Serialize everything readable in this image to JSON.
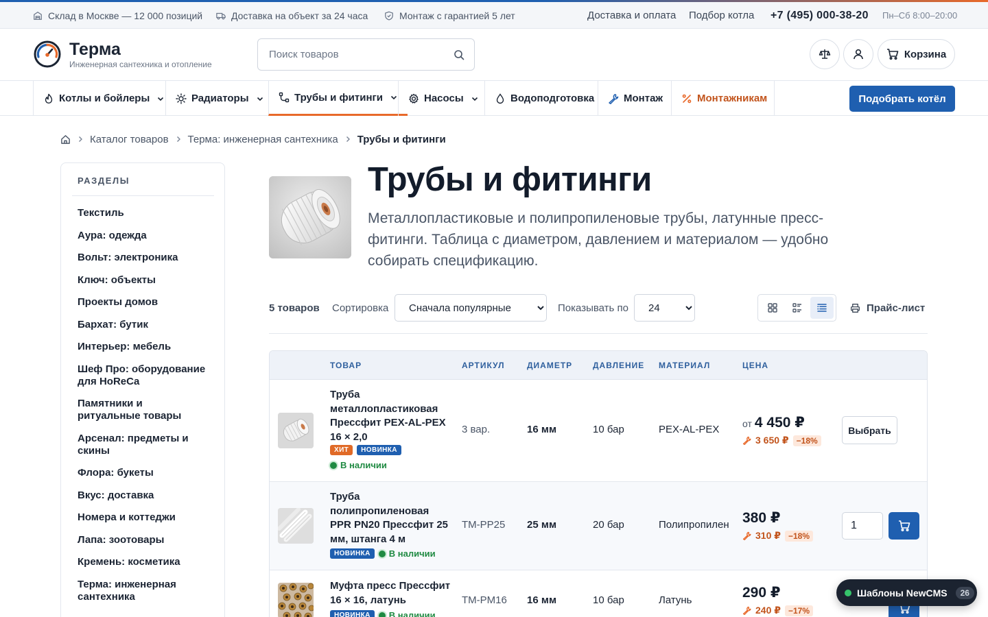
{
  "topbar": {
    "items": [
      "Склад в Москве — 12 000 позиций",
      "Доставка на объект за 24 часа",
      "Монтаж с гарантией 5 лет"
    ],
    "links": [
      "Доставка и оплата",
      "Подбор котла"
    ],
    "phone": "+7 (495) 000-38-20",
    "hours": "Пн–Сб 8:00–20:00"
  },
  "header": {
    "brand": "Терма",
    "tagline": "Инженерная сантехника и отопление",
    "search_placeholder": "Поиск товаров",
    "cart_label": "Корзина"
  },
  "nav": {
    "items": [
      "Котлы и бойлеры",
      "Радиаторы",
      "Трубы и фитинги",
      "Насосы",
      "Водоподготовка",
      "Монтаж",
      "Монтажникам"
    ],
    "active": "Трубы и фитинги",
    "cta": "Подобрать котёл"
  },
  "breadcrumb": [
    "Каталог товаров",
    "Терма: инженерная сантехника",
    "Трубы и фитинги"
  ],
  "sidebar": {
    "title": "РАЗДЕЛЫ",
    "items": [
      "Текстиль",
      "Аура: одежда",
      "Вольт: электроника",
      "Ключ: объекты",
      "Проекты домов",
      "Бархат: бутик",
      "Интерьер: мебель",
      "Шеф Про: оборудование для HoReCa",
      "Памятники и ритуальные товары",
      "Арсенал: предметы и скины",
      "Флора: букеты",
      "Вкус: доставка",
      "Номера и коттеджи",
      "Лапа: зоотовары",
      "Кремень: косметика",
      "Терма: инженерная сантехника"
    ]
  },
  "category": {
    "title": "Трубы и фитинги",
    "description": "Металлопластиковые и полипропиленовые трубы, латунные пресс-фитинги. Таблица с диаметром, давлением и материалом — удобно собирать спецификацию."
  },
  "toolbar": {
    "count": "5 товаров",
    "sort_label": "Сортировка",
    "sort_value": "Сначала популярные",
    "per_page_label": "Показывать по",
    "per_page_value": "24",
    "active_view": "table",
    "price_list": "Прайс-лист"
  },
  "table": {
    "headers": [
      "ТОВАР",
      "АРТИКУЛ",
      "ДИАМЕТР",
      "ДАВЛЕНИЕ",
      "МАТЕРИАЛ",
      "ЦЕНА"
    ],
    "rows": [
      {
        "name": "Труба металлопластиковая Прессфит PEX-AL-PEX 16 × 2,0",
        "badges": [
          "ХИТ",
          "НОВИНКА"
        ],
        "stock": "В наличии",
        "sku": "3 вар.",
        "diameter": "16 мм",
        "pressure": "10 бар",
        "material": "PEX-AL-PEX",
        "price_prefix": "от",
        "price": "4 450 ₽",
        "pro_price": "3 650 ₽",
        "discount": "−18%",
        "action": "Выбрать"
      },
      {
        "name": "Труба полипропиленовая PPR PN20 Прессфит 25 мм, штанга 4 м",
        "badges": [
          "НОВИНКА"
        ],
        "stock": "В наличии",
        "sku": "TM-PP25",
        "diameter": "25 мм",
        "pressure": "20 бар",
        "material": "Полипропилен",
        "price_prefix": "",
        "price": "380 ₽",
        "pro_price": "310 ₽",
        "discount": "−18%",
        "qty": "1"
      },
      {
        "name": "Муфта пресс Прессфит 16 × 16, латунь",
        "badges": [
          "НОВИНКА"
        ],
        "stock": "В наличии",
        "sku": "TM-PM16",
        "diameter": "16 мм",
        "pressure": "10 бар",
        "material": "Латунь",
        "price_prefix": "",
        "price": "290 ₽",
        "pro_price": "240 ₽",
        "discount": "−17%"
      }
    ]
  },
  "floating": {
    "label": "Шаблоны NewCMS",
    "count": "26"
  },
  "colors": {
    "primary": "#1f5fb0",
    "accent": "#e8692a",
    "in_stock": "#1f8a42"
  }
}
